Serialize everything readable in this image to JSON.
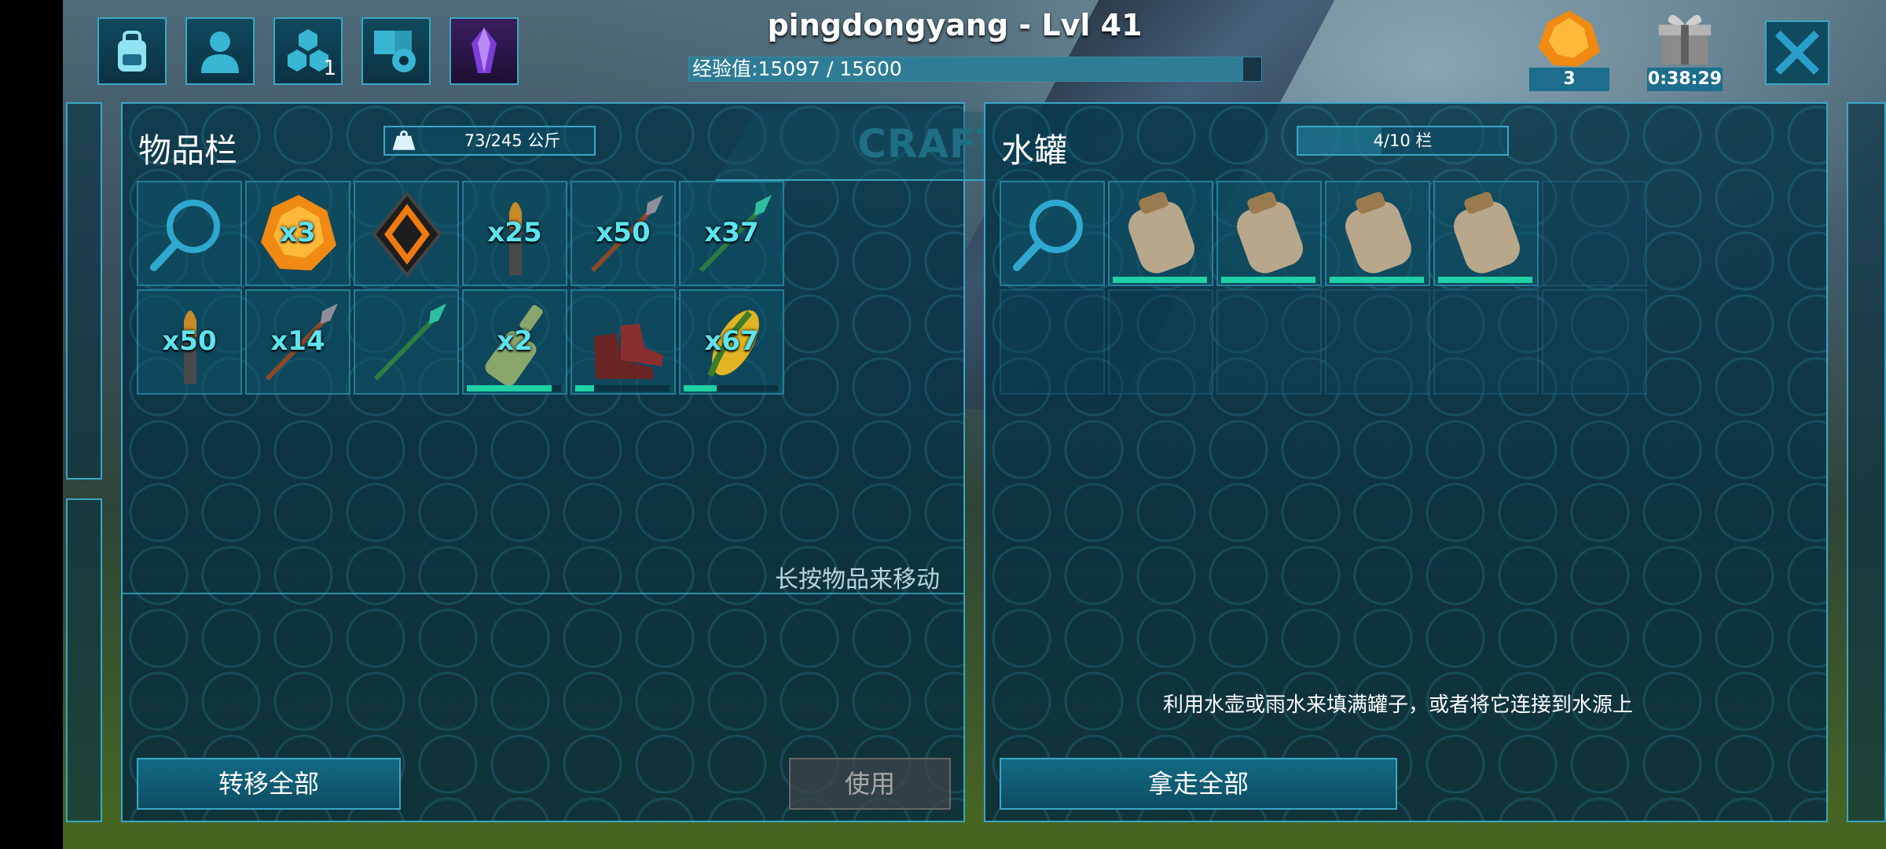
{
  "header": {
    "player_title": "pingdongyang - Lvl 41",
    "xp_text": "经验值:15097 / 15600",
    "xp_progress": 0.968,
    "tribe_count": "1",
    "amber_count": "3",
    "gift_timer": "0:38:29"
  },
  "top_icons": [
    "backpack-icon",
    "character-icon",
    "tribe-icon",
    "settings-icon",
    "crystal-icon"
  ],
  "inventory": {
    "title": "物品栏",
    "weight": "73/245 公斤",
    "crafting_label": "CRAFTING",
    "hint": "长按物品来移动",
    "transfer_all_label": "转移全部",
    "use_label": "使用",
    "slots": [
      {
        "icon": "search-icon",
        "qty": ""
      },
      {
        "icon": "amber-icon",
        "qty": "x3"
      },
      {
        "icon": "implant-icon",
        "qty": ""
      },
      {
        "icon": "bullet-icon",
        "qty": "x25"
      },
      {
        "icon": "stone-arrow-icon",
        "qty": "x50"
      },
      {
        "icon": "tranq-arrow-icon",
        "qty": "x37"
      },
      {
        "icon": "bullet-icon",
        "qty": "x50"
      },
      {
        "icon": "stone-arrow-icon",
        "qty": "x14"
      },
      {
        "icon": "tranq-arrow-icon",
        "qty": ""
      },
      {
        "icon": "bottle-icon",
        "qty": "x2",
        "durability": 0.9
      },
      {
        "icon": "boots-icon",
        "qty": "",
        "durability": 0.2
      },
      {
        "icon": "corn-icon",
        "qty": "x67",
        "durability": 0.35
      }
    ]
  },
  "water_tank": {
    "title": "水罐",
    "slots_text": "4/10 栏",
    "hint": "利用水壶或雨水来填满罐子，或者将它连接到水源上",
    "take_all_label": "拿走全部",
    "slots": [
      {
        "icon": "search-icon"
      },
      {
        "icon": "waterskin-icon",
        "durability": 1.0
      },
      {
        "icon": "waterskin-icon",
        "durability": 1.0
      },
      {
        "icon": "waterskin-icon",
        "durability": 1.0
      },
      {
        "icon": "waterskin-icon",
        "durability": 1.0
      }
    ]
  }
}
